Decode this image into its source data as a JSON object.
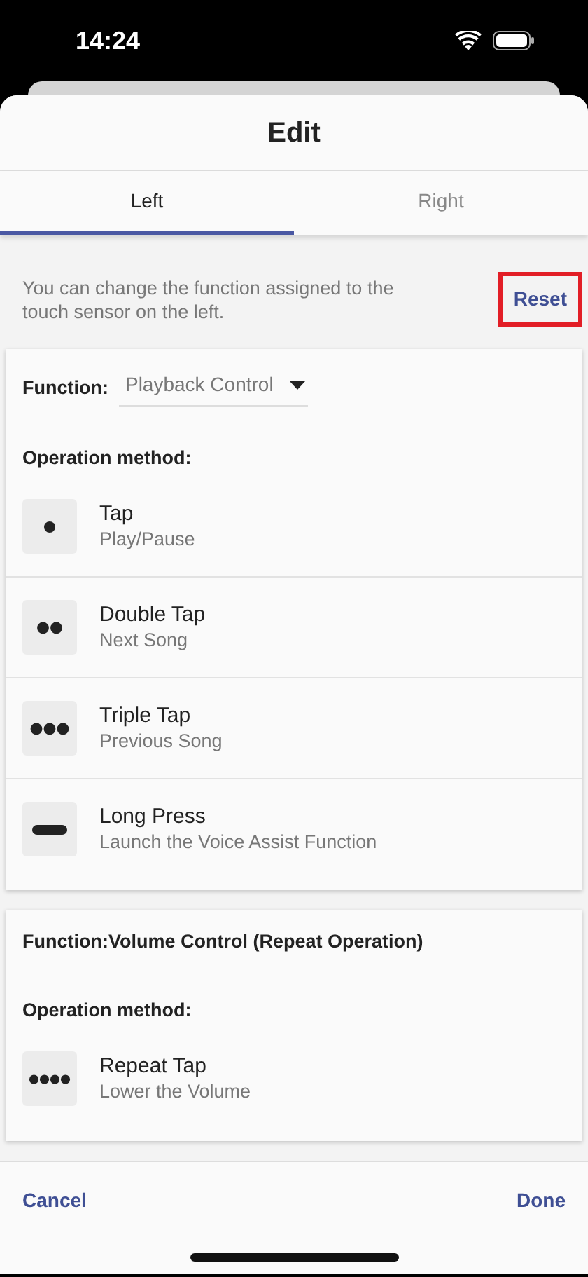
{
  "status_bar": {
    "time": "14:24"
  },
  "title": "Edit",
  "tabs": [
    {
      "label": "Left",
      "selected": true
    },
    {
      "label": "Right",
      "selected": false
    }
  ],
  "description": "You can change the function assigned to the touch sensor on the left.",
  "reset": {
    "label": "Reset",
    "highlighted": true
  },
  "sections": [
    {
      "function_label": "Function:",
      "function_value": "Playback Control",
      "dropdown": true,
      "operation_label": "Operation method:",
      "operations": [
        {
          "kind": "tap",
          "name": "Tap",
          "action": "Play/Pause"
        },
        {
          "kind": "double",
          "name": "Double Tap",
          "action": "Next Song"
        },
        {
          "kind": "triple",
          "name": "Triple Tap",
          "action": "Previous Song"
        },
        {
          "kind": "long",
          "name": "Long Press",
          "action": "Launch the Voice Assist Function"
        }
      ]
    },
    {
      "function_label": "Function:",
      "function_value": "Volume Control (Repeat Operation)",
      "dropdown": false,
      "operation_label": "Operation method:",
      "operations": [
        {
          "kind": "repeat",
          "name": "Repeat Tap",
          "action": "Lower the Volume"
        }
      ]
    }
  ],
  "footer": {
    "cancel": "Cancel",
    "done": "Done"
  }
}
